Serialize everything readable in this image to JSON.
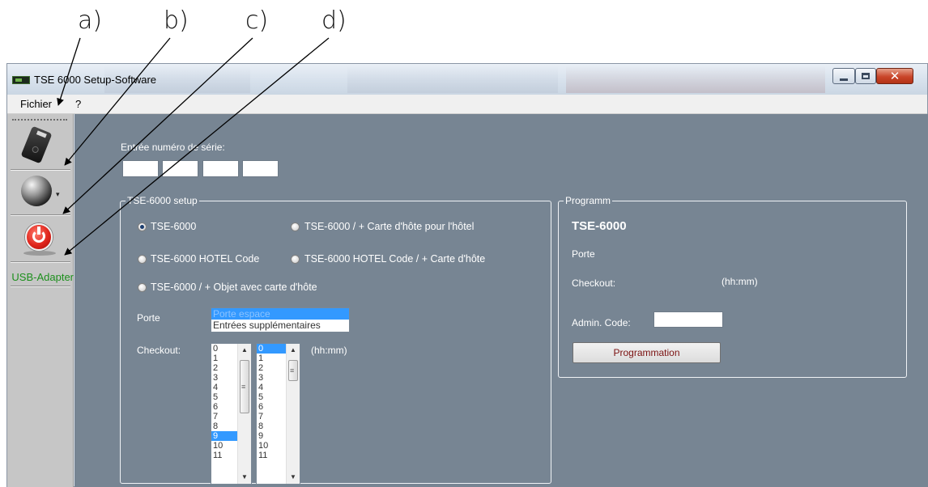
{
  "annotations": {
    "a": "a)",
    "b": "b)",
    "c": "c)",
    "d": "d)"
  },
  "window": {
    "title": "TSE 6000 Setup-Software",
    "controls": {
      "minimize_icon": "minimize-icon",
      "maximize_icon": "maximize-icon",
      "close_icon": "close-icon"
    }
  },
  "menu": {
    "file": "Fichier",
    "help": "?"
  },
  "toolbar": {
    "items": [
      {
        "icon": "device-icon"
      },
      {
        "icon": "globe-icon",
        "dropdown": "▾"
      },
      {
        "icon": "power-icon"
      }
    ],
    "usb_label": "USB-Adapter"
  },
  "serial": {
    "label": "Entrée numéro de série:",
    "fields": [
      "",
      "",
      "",
      ""
    ]
  },
  "setup": {
    "title": "TSE-6000 setup",
    "options": [
      {
        "label": "TSE-6000",
        "checked": true
      },
      {
        "label": "TSE-6000 / + Carte d'hôte pour l'hôtel",
        "checked": false
      },
      {
        "label": "TSE-6000 HOTEL Code",
        "checked": false
      },
      {
        "label": "TSE-6000 HOTEL Code / + Carte d'hôte",
        "checked": false
      },
      {
        "label": "TSE-6000 / + Objet avec carte d'hôte",
        "checked": false
      }
    ],
    "door_label": "Porte",
    "door_options": [
      "Porte espace",
      "Entrées supplémentaires"
    ],
    "door_selected": "Porte espace",
    "checkout_label": "Checkout:",
    "hours": [
      "0",
      "1",
      "2",
      "3",
      "4",
      "5",
      "6",
      "7",
      "8",
      "9",
      "10",
      "11"
    ],
    "hours_selected": "9",
    "minutes": [
      "0",
      "1",
      "2",
      "3",
      "4",
      "5",
      "6",
      "7",
      "8",
      "9",
      "10",
      "11"
    ],
    "minutes_selected": "0",
    "time_unit": "(hh:mm)"
  },
  "program": {
    "title": "Programm",
    "device": "TSE-6000",
    "door_label": "Porte",
    "checkout_label": "Checkout:",
    "time_unit": "(hh:mm)",
    "admin_code_label": "Admin. Code:",
    "admin_code_value": "",
    "button_label": "Programmation"
  }
}
